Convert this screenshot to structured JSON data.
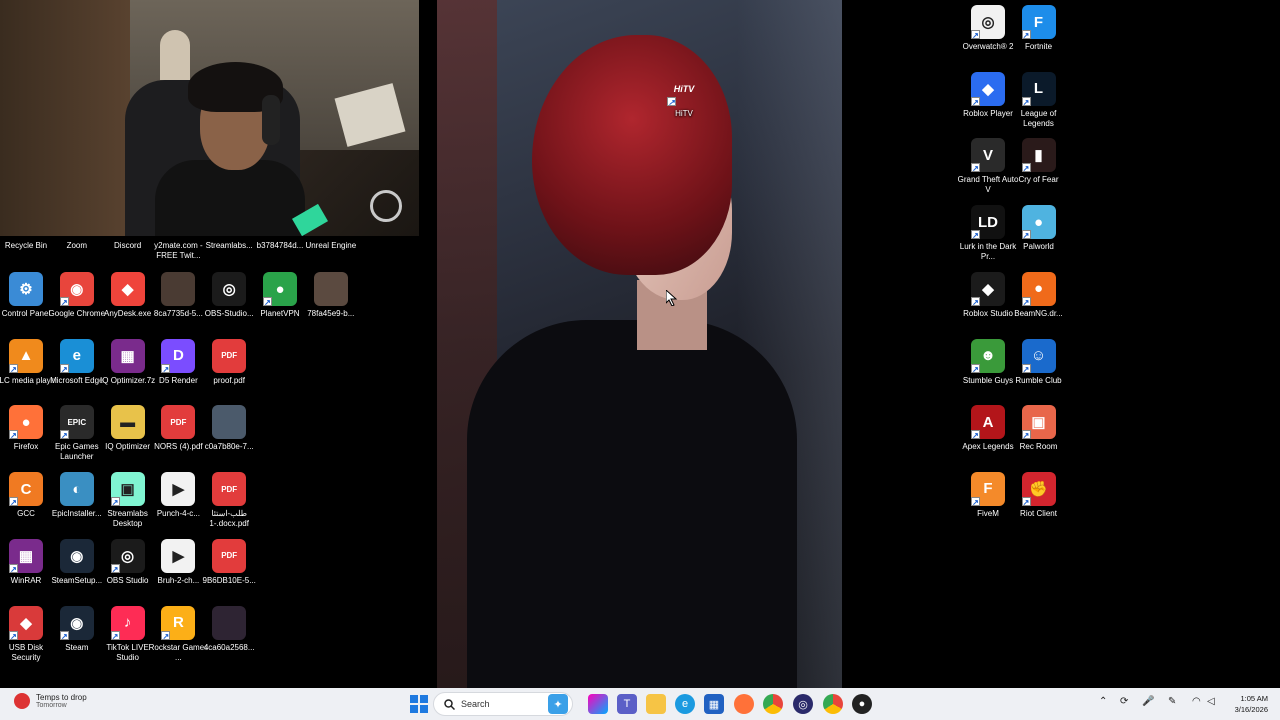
{
  "desktop_icons": [
    {
      "label": "Recycle Bin",
      "col": 0,
      "row": 0,
      "color": "#2f6cc2",
      "glyph": "",
      "shortcut": false
    },
    {
      "label": "Zoom",
      "col": 1,
      "row": 0,
      "color": "#2d8cff",
      "glyph": "",
      "shortcut": false
    },
    {
      "label": "Discord",
      "col": 2,
      "row": 0,
      "color": "#5865f2",
      "glyph": "",
      "shortcut": false
    },
    {
      "label": "y2mate.com - FREE Twit...",
      "col": 3,
      "row": 0,
      "color": "#555",
      "glyph": "",
      "shortcut": false
    },
    {
      "label": "Streamlabs...",
      "col": 4,
      "row": 0,
      "color": "#80f5d2",
      "glyph": "",
      "shortcut": false
    },
    {
      "label": "b3784784d...",
      "col": 5,
      "row": 0,
      "color": "#666",
      "glyph": "",
      "shortcut": false
    },
    {
      "label": "Unreal Engine",
      "col": 6,
      "row": 0,
      "color": "#222",
      "glyph": "",
      "shortcut": false
    },
    {
      "label": "Control Panel",
      "col": 0,
      "row": 1,
      "color": "#3a8bd6",
      "glyph": "⚙",
      "shortcut": false
    },
    {
      "label": "Google Chrome",
      "col": 1,
      "row": 1,
      "color": "#e8453c",
      "glyph": "◉",
      "shortcut": true
    },
    {
      "label": "AnyDesk.exe",
      "col": 2,
      "row": 1,
      "color": "#ef443b",
      "glyph": "◆",
      "shortcut": false
    },
    {
      "label": "8ca7735d-5...",
      "col": 3,
      "row": 1,
      "color": "#4a3b33",
      "glyph": "",
      "shortcut": false
    },
    {
      "label": "OBS-Studio...",
      "col": 4,
      "row": 1,
      "color": "#1b1b1b",
      "glyph": "◎",
      "shortcut": false
    },
    {
      "label": "PlanetVPN",
      "col": 5,
      "row": 1,
      "color": "#2aa34a",
      "glyph": "●",
      "shortcut": true
    },
    {
      "label": "78fa45e9-b...",
      "col": 6,
      "row": 1,
      "color": "#5b4a40",
      "glyph": "",
      "shortcut": false
    },
    {
      "label": "VLC media player",
      "col": 0,
      "row": 2,
      "color": "#f08a1c",
      "glyph": "▲",
      "shortcut": true
    },
    {
      "label": "Microsoft Edge",
      "col": 1,
      "row": 2,
      "color": "#1a8fd6",
      "glyph": "e",
      "shortcut": true
    },
    {
      "label": "IQ Optimizer.7z",
      "col": 2,
      "row": 2,
      "color": "#7a2b8c",
      "glyph": "▦",
      "shortcut": false
    },
    {
      "label": "D5 Render",
      "col": 3,
      "row": 2,
      "color": "#7b4dff",
      "glyph": "D",
      "shortcut": true
    },
    {
      "label": "proof.pdf",
      "col": 4,
      "row": 2,
      "color": "#e23c3c",
      "glyph": "PDF",
      "shortcut": false
    },
    {
      "label": "Firefox",
      "col": 0,
      "row": 3,
      "color": "#ff7139",
      "glyph": "●",
      "shortcut": true
    },
    {
      "label": "Epic Games Launcher",
      "col": 1,
      "row": 3,
      "color": "#2a2a2a",
      "glyph": "EPIC",
      "shortcut": true
    },
    {
      "label": "IQ Optimizer",
      "col": 2,
      "row": 3,
      "color": "#e8c24a",
      "glyph": "▬",
      "shortcut": false
    },
    {
      "label": "NORS (4).pdf",
      "col": 3,
      "row": 3,
      "color": "#e23c3c",
      "glyph": "PDF",
      "shortcut": false
    },
    {
      "label": "c0a7b80e-7...",
      "col": 4,
      "row": 3,
      "color": "#4b5a6b",
      "glyph": "",
      "shortcut": false
    },
    {
      "label": "GCC",
      "col": 0,
      "row": 4,
      "color": "#f07a22",
      "glyph": "C",
      "shortcut": true
    },
    {
      "label": "EpicInstaller...",
      "col": 1,
      "row": 4,
      "color": "#3a8fc2",
      "glyph": "◐",
      "shortcut": false
    },
    {
      "label": "Streamlabs Desktop",
      "col": 2,
      "row": 4,
      "color": "#80f5d2",
      "glyph": "▣",
      "shortcut": true
    },
    {
      "label": "Punch-4-c...",
      "col": 3,
      "row": 4,
      "color": "#f2f2f2",
      "glyph": "▶",
      "shortcut": false
    },
    {
      "label": "طلب-استئا -1.docx.pdf",
      "col": 4,
      "row": 4,
      "color": "#e23c3c",
      "glyph": "PDF",
      "shortcut": false
    },
    {
      "label": "WinRAR",
      "col": 0,
      "row": 5,
      "color": "#7a2b8c",
      "glyph": "▦",
      "shortcut": true
    },
    {
      "label": "SteamSetup...",
      "col": 1,
      "row": 5,
      "color": "#1b2838",
      "glyph": "◉",
      "shortcut": false
    },
    {
      "label": "OBS Studio",
      "col": 2,
      "row": 5,
      "color": "#1b1b1b",
      "glyph": "◎",
      "shortcut": true
    },
    {
      "label": "Bruh-2-ch...",
      "col": 3,
      "row": 5,
      "color": "#f2f2f2",
      "glyph": "▶",
      "shortcut": false
    },
    {
      "label": "9B6DB10E-5...",
      "col": 4,
      "row": 5,
      "color": "#e23c3c",
      "glyph": "PDF",
      "shortcut": false
    },
    {
      "label": "USB Disk Security",
      "col": 0,
      "row": 6,
      "color": "#d93a3a",
      "glyph": "◆",
      "shortcut": true
    },
    {
      "label": "Steam",
      "col": 1,
      "row": 6,
      "color": "#1b2838",
      "glyph": "◉",
      "shortcut": true
    },
    {
      "label": "TikTok LIVE Studio",
      "col": 2,
      "row": 6,
      "color": "#fe2c55",
      "glyph": "♪",
      "shortcut": true
    },
    {
      "label": "Rockstar Games ...",
      "col": 3,
      "row": 6,
      "color": "#fcaf17",
      "glyph": "R",
      "shortcut": true
    },
    {
      "label": "4ca60a2568...",
      "col": 4,
      "row": 6,
      "color": "#2e2433",
      "glyph": "",
      "shortcut": false
    }
  ],
  "right_icons": [
    {
      "label": "Overwatch® 2",
      "color": "#f1f1f1",
      "glyph": "◎",
      "shortcut": true
    },
    {
      "label": "Fortnite",
      "color": "#1d8dea",
      "glyph": "F",
      "shortcut": true
    },
    {
      "label": "Roblox Player",
      "color": "#2b6cf0",
      "glyph": "◆",
      "shortcut": true
    },
    {
      "label": "League of Legends",
      "color": "#0b1a2a",
      "glyph": "L",
      "shortcut": true
    },
    {
      "label": "Grand Theft Auto V",
      "color": "#2a2a2a",
      "glyph": "V",
      "shortcut": true
    },
    {
      "label": "Cry of Fear",
      "color": "#2a1a1a",
      "glyph": "▮",
      "shortcut": true
    },
    {
      "label": "Lurk in the Dark  Pr...",
      "color": "#111",
      "glyph": "LD",
      "shortcut": true
    },
    {
      "label": "Palworld",
      "color": "#4fb3e0",
      "glyph": "●",
      "shortcut": true
    },
    {
      "label": "Roblox Studio",
      "color": "#1b1b1b",
      "glyph": "◆",
      "shortcut": true
    },
    {
      "label": "BeamNG.dr...",
      "color": "#f06a1a",
      "glyph": "●",
      "shortcut": true
    },
    {
      "label": "Stumble Guys",
      "color": "#3a9a3a",
      "glyph": "☻",
      "shortcut": true
    },
    {
      "label": "Rumble Club",
      "color": "#1a6acc",
      "glyph": "☺",
      "shortcut": true
    },
    {
      "label": "Apex Legends",
      "color": "#b3151a",
      "glyph": "A",
      "shortcut": true
    },
    {
      "label": "Rec Room",
      "color": "#e8664a",
      "glyph": "▣",
      "shortcut": true
    },
    {
      "label": "FiveM",
      "color": "#f48a2a",
      "glyph": "F",
      "shortcut": true
    },
    {
      "label": "Riot Client",
      "color": "#d3252e",
      "glyph": "✊",
      "shortcut": true
    }
  ],
  "wallpaper_icon": {
    "label": "HiTV",
    "glyph": "HiTV",
    "color": "#d92a86"
  },
  "taskbar": {
    "weather_line1": "Temps to drop",
    "weather_line2": "Tomorrow",
    "search_placeholder": "Search",
    "time": "1:05 AM",
    "date": "3/16/2026"
  }
}
